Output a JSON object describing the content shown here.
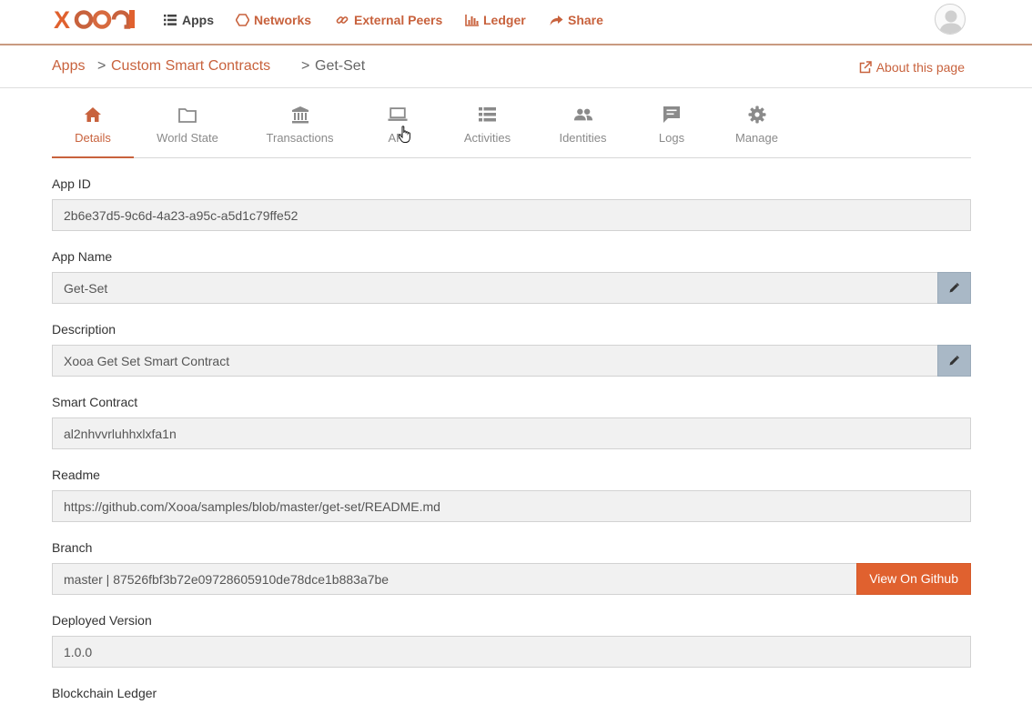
{
  "nav": {
    "logo_text": "Xooa",
    "items": [
      {
        "label": "Apps",
        "icon": "list-icon"
      },
      {
        "label": "Networks",
        "icon": "hexagon-icon"
      },
      {
        "label": "External Peers",
        "icon": "link-icon"
      },
      {
        "label": "Ledger",
        "icon": "bar-chart-icon"
      },
      {
        "label": "Share",
        "icon": "share-arrow-icon"
      }
    ]
  },
  "breadcrumb": {
    "apps": "Apps",
    "sep1": ">",
    "custom": "Custom Smart Contracts",
    "sep2": ">",
    "current": "Get-Set"
  },
  "about_link": "About this page",
  "tabs": [
    {
      "label": "Details",
      "icon": "home-icon"
    },
    {
      "label": "World State",
      "icon": "folder-icon"
    },
    {
      "label": "Transactions",
      "icon": "bank-icon"
    },
    {
      "label": "API",
      "icon": "laptop-icon"
    },
    {
      "label": "Activities",
      "icon": "list-icon"
    },
    {
      "label": "Identities",
      "icon": "people-icon"
    },
    {
      "label": "Logs",
      "icon": "comment-icon"
    },
    {
      "label": "Manage",
      "icon": "gear-icon"
    }
  ],
  "form": {
    "app_id": {
      "label": "App ID",
      "value": "2b6e37d5-9c6d-4a23-a95c-a5d1c79ffe52"
    },
    "app_name": {
      "label": "App Name",
      "value": "Get-Set"
    },
    "description": {
      "label": "Description",
      "value": "Xooa Get Set Smart Contract"
    },
    "smart_contract": {
      "label": "Smart Contract",
      "value": "al2nhvvrluhhxlxfa1n"
    },
    "readme": {
      "label": "Readme",
      "value": "https://github.com/Xooa/samples/blob/master/get-set/README.md"
    },
    "branch": {
      "label": "Branch",
      "value": "master | 87526fbf3b72e09728605910de78dce1b883a7be",
      "button": "View On Github"
    },
    "deployed_version": {
      "label": "Deployed Version",
      "value": "1.0.0"
    },
    "blockchain_ledger": {
      "label": "Blockchain Ledger"
    }
  },
  "colors": {
    "accent": "#c8623d",
    "button": "#e0612f",
    "edit_button": "#a9b8c6"
  }
}
